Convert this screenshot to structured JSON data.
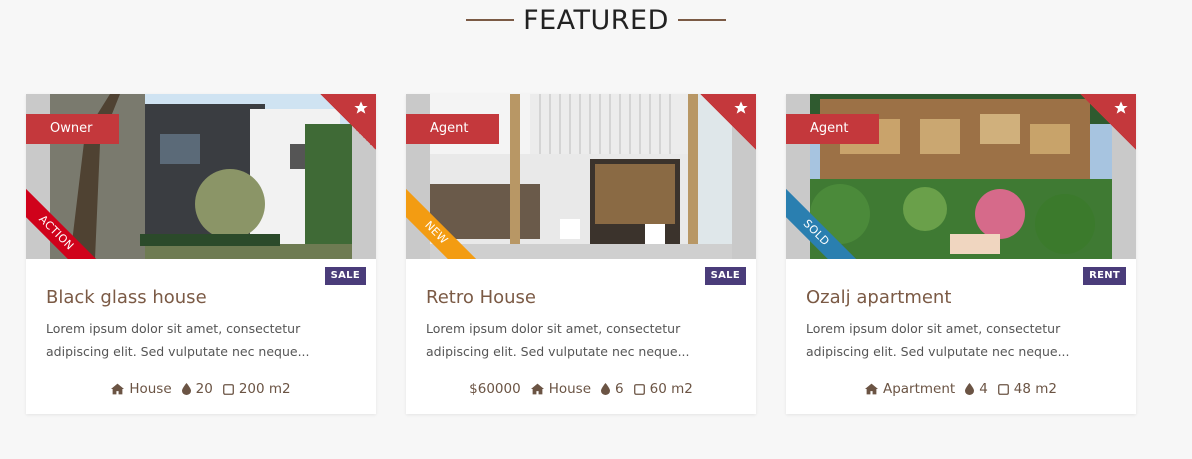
{
  "section": {
    "title": "FEATURED"
  },
  "colors": {
    "accent": "#7b5a45",
    "ribbon": "#c4383c",
    "tag": "#4a3c7a",
    "action": "#d0021b",
    "new": "#f39c12",
    "sold": "#2a7fb0"
  },
  "listings": [
    {
      "owner_label": "Owner",
      "diag_label": "ACTION",
      "diag_color": "#d0021b",
      "status": "SALE",
      "title": "Black glass house",
      "description": "Lorem ipsum dolor sit amet, consectetur adipiscing elit. Sed vulputate nec neque...",
      "price": "",
      "type": "House",
      "bath": "20",
      "area": "200 m2",
      "type_icon": "house-icon"
    },
    {
      "owner_label": "Agent",
      "diag_label": "NEW",
      "diag_color": "#f39c12",
      "status": "SALE",
      "title": "Retro House",
      "description": "Lorem ipsum dolor sit amet, consectetur adipiscing elit. Sed vulputate nec neque...",
      "price": "$60000",
      "type": "House",
      "bath": "6",
      "area": "60 m2",
      "type_icon": "house-icon"
    },
    {
      "owner_label": "Agent",
      "diag_label": "SOLD",
      "diag_color": "#2a7fb0",
      "status": "RENT",
      "title": "Ozalj apartment",
      "description": "Lorem ipsum dolor sit amet, consectetur adipiscing elit. Sed vulputate nec neque...",
      "price": "",
      "type": "Apartment",
      "bath": "4",
      "area": "48 m2",
      "type_icon": "house-icon"
    }
  ]
}
